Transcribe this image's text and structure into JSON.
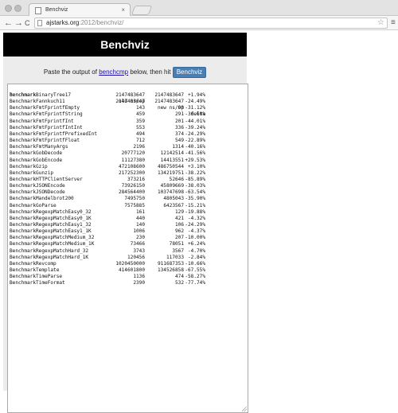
{
  "browser": {
    "tab_title": "Benchviz",
    "tab_close": "×",
    "url_host": "ajstarks.org",
    "url_path": ":2012/benchviz/",
    "back_icon": "←",
    "forward_icon": "→",
    "reload_icon": "C",
    "star_icon": "☆",
    "menu_icon": "≡"
  },
  "page": {
    "title": "Benchviz",
    "intro_prefix": "Paste the output of ",
    "intro_link": "benchcmp",
    "intro_suffix": " below, then hit ",
    "button_label": "Benchviz"
  },
  "table": {
    "headers": {
      "name": "benchmark",
      "old": "old ns/op",
      "new": "new ns/op",
      "delta": "delta"
    },
    "rows": [
      {
        "name": "BenchmarkBinaryTree17",
        "old": "2147483647",
        "new": "2147483647",
        "delta": "+1.94%"
      },
      {
        "name": "BenchmarkFannkuch11",
        "old": "2147483647",
        "new": "2147483647",
        "delta": "-24.49%"
      },
      {
        "name": "BenchmarkFmtFprintfEmpty",
        "old": "143",
        "new": "98",
        "delta": "-31.12%"
      },
      {
        "name": "BenchmarkFmtFprintfString",
        "old": "459",
        "new": "291",
        "delta": "-36.60%"
      },
      {
        "name": "BenchmarkFmtFprintfInt",
        "old": "359",
        "new": "201",
        "delta": "-44.01%"
      },
      {
        "name": "BenchmarkFmtFprintfIntInt",
        "old": "553",
        "new": "336",
        "delta": "-39.24%"
      },
      {
        "name": "BenchmarkFmtFprintfPrefixedInt",
        "old": "494",
        "new": "374",
        "delta": "-24.29%"
      },
      {
        "name": "BenchmarkFmtFprintfFloat",
        "old": "712",
        "new": "549",
        "delta": "-22.89%"
      },
      {
        "name": "BenchmarkFmtManyArgs",
        "old": "2196",
        "new": "1314",
        "delta": "-40.16%"
      },
      {
        "name": "BenchmarkGobDecode",
        "old": "20777120",
        "new": "12142514",
        "delta": "-41.56%"
      },
      {
        "name": "BenchmarkGobEncode",
        "old": "11127380",
        "new": "14413551",
        "delta": "+29.53%"
      },
      {
        "name": "BenchmarkGzip",
        "old": "472108600",
        "new": "486750544",
        "delta": "+3.10%"
      },
      {
        "name": "BenchmarkGunzip",
        "old": "217252300",
        "new": "134219751",
        "delta": "-38.22%"
      },
      {
        "name": "BenchmarkHTTPClientServer",
        "old": "373216",
        "new": "52646",
        "delta": "-85.89%"
      },
      {
        "name": "BenchmarkJSONEncode",
        "old": "73926150",
        "new": "45809669",
        "delta": "-38.03%"
      },
      {
        "name": "BenchmarkJSONDecode",
        "old": "284564400",
        "new": "103747698",
        "delta": "-63.54%"
      },
      {
        "name": "BenchmarkMandelbrot200",
        "old": "7495750",
        "new": "4805043",
        "delta": "-35.90%"
      },
      {
        "name": "BenchmarkGoParse",
        "old": "7575885",
        "new": "6423567",
        "delta": "-15.21%"
      },
      {
        "name": "BenchmarkRegexpMatchEasy0_32",
        "old": "161",
        "new": "129",
        "delta": "-19.88%"
      },
      {
        "name": "BenchmarkRegexpMatchEasy0_1K",
        "old": "440",
        "new": "421",
        "delta": "-4.32%"
      },
      {
        "name": "BenchmarkRegexpMatchEasy1_32",
        "old": "140",
        "new": "106",
        "delta": "-24.29%"
      },
      {
        "name": "BenchmarkRegexpMatchEasy1_1K",
        "old": "1006",
        "new": "962",
        "delta": "-4.37%"
      },
      {
        "name": "BenchmarkRegexpMatchMedium_32",
        "old": "230",
        "new": "207",
        "delta": "-10.00%"
      },
      {
        "name": "BenchmarkRegexpMatchMedium_1K",
        "old": "73466",
        "new": "78051",
        "delta": "+6.24%"
      },
      {
        "name": "BenchmarkRegexpMatchHard_32",
        "old": "3743",
        "new": "3567",
        "delta": "-4.70%"
      },
      {
        "name": "BenchmarkRegexpMatchHard_1K",
        "old": "120456",
        "new": "117033",
        "delta": "-2.84%"
      },
      {
        "name": "BenchmarkRevcomp",
        "old": "1020450000",
        "new": "911687353",
        "delta": "-10.66%"
      },
      {
        "name": "BenchmarkTemplate",
        "old": "414601800",
        "new": "134526858",
        "delta": "-67.55%"
      },
      {
        "name": "BenchmarkTimeParse",
        "old": "1136",
        "new": "474",
        "delta": "-58.27%"
      },
      {
        "name": "BenchmarkTimeFormat",
        "old": "2390",
        "new": "532",
        "delta": "-77.74%"
      }
    ]
  }
}
